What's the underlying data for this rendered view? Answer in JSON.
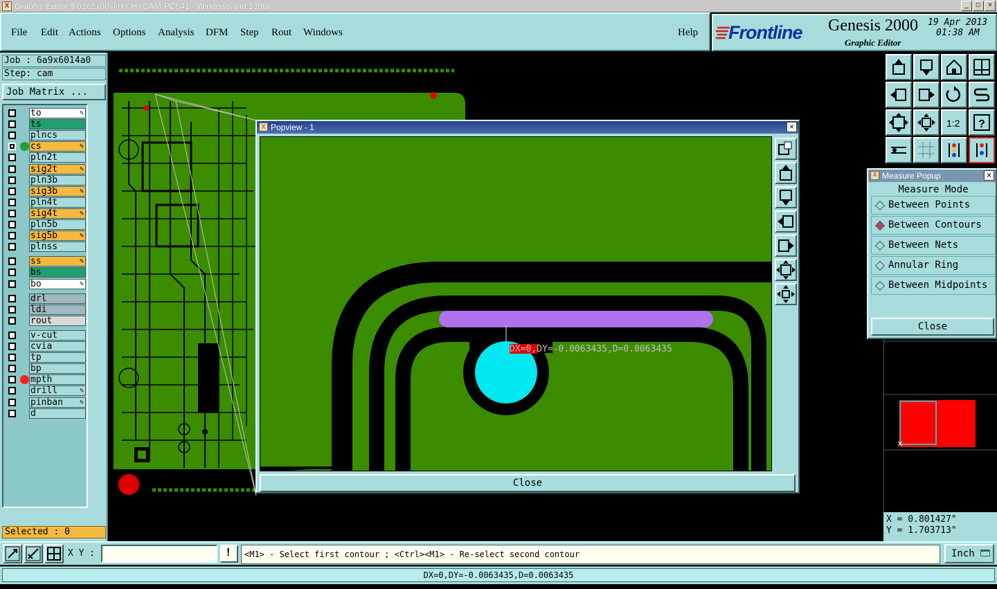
{
  "window": {
    "title": "Graphic Editor 9.02c2 (00@HY-HYCAM-PC041 - Windows, pid:1396)",
    "controls": [
      "_",
      "□",
      "×"
    ]
  },
  "menu": {
    "items": [
      "File",
      "Edit",
      "Actions",
      "Options",
      "Analysis",
      "DFM",
      "Step",
      "Rout",
      "Windows"
    ],
    "help": "Help"
  },
  "brand": {
    "logo": "Frontline",
    "product": "Genesis 2000",
    "subtitle": "Graphic Editor",
    "date": "19 Apr 2013",
    "time": "01:38 AM"
  },
  "job": {
    "job_label": "Job : 6a9x6014a0",
    "step_label": "Step: cam",
    "matrix_button": "Job Matrix ..."
  },
  "layers": [
    {
      "name": "to",
      "color": "#ffffff",
      "flag": "pencil"
    },
    {
      "name": "ts",
      "color": "#20a070",
      "flag": ""
    },
    {
      "name": "plncs",
      "color": "#a8dcdc",
      "flag": ""
    },
    {
      "name": "cs",
      "color": "#f5b840",
      "flag": "pencil",
      "active": true,
      "dot": "#20a040"
    },
    {
      "name": "pln2t",
      "color": "#a8dcdc",
      "flag": ""
    },
    {
      "name": "sig2t",
      "color": "#f5b840",
      "flag": "pencil"
    },
    {
      "name": "pln3b",
      "color": "#a8dcdc",
      "flag": ""
    },
    {
      "name": "sig3b",
      "color": "#f5b840",
      "flag": "pencil"
    },
    {
      "name": "pln4t",
      "color": "#a8dcdc",
      "flag": ""
    },
    {
      "name": "sig4t",
      "color": "#f5b840",
      "flag": "pencil"
    },
    {
      "name": "pln5b",
      "color": "#a8dcdc",
      "flag": ""
    },
    {
      "name": "sig5b",
      "color": "#f5b840",
      "flag": "pencil"
    },
    {
      "name": "plnss",
      "color": "#a8dcdc",
      "flag": ""
    },
    {
      "name": "ss",
      "color": "#f5b840",
      "flag": "pencil"
    },
    {
      "name": "bs",
      "color": "#20a070",
      "flag": ""
    },
    {
      "name": "bo",
      "color": "#ffffff",
      "flag": "pencil"
    },
    {
      "name": "drl",
      "color": "#a0b8c0",
      "flag": ""
    },
    {
      "name": "ldi",
      "color": "#a0b8c0",
      "flag": ""
    },
    {
      "name": "rout",
      "color": "#d8d8d8",
      "flag": ""
    },
    {
      "name": "v-cut",
      "color": "#a8dcdc",
      "flag": ""
    },
    {
      "name": "cvia",
      "color": "#a8dcdc",
      "flag": ""
    },
    {
      "name": "tp",
      "color": "#a8dcdc",
      "flag": ""
    },
    {
      "name": "bp",
      "color": "#a8dcdc",
      "flag": ""
    },
    {
      "name": "mpth",
      "color": "#a8dcdc",
      "flag": "",
      "dot": "#ff2020"
    },
    {
      "name": "drill",
      "color": "#a8dcdc",
      "flag": "pencil"
    },
    {
      "name": "pinban",
      "color": "#a8dcdc",
      "flag": "pencil"
    },
    {
      "name": "d",
      "color": "#a8dcdc",
      "flag": ""
    }
  ],
  "selected": "Selected : 0",
  "popview": {
    "title": "Popview - 1",
    "measure_text": "DX=0,DY=-0.0063435,D=0.0063435",
    "close": "Close"
  },
  "measure_popup": {
    "title": "Measure Popup",
    "heading": "Measure Mode",
    "options": [
      "Between Points",
      "Between Contours",
      "Between Nets",
      "Annular Ring",
      "Between Midpoints"
    ],
    "selected_option": "Between Contours",
    "close": "Close"
  },
  "coords": {
    "x": "X = 0.801427\"",
    "y": "Y = 1.703713\""
  },
  "command": {
    "xy_label": "X Y :",
    "xy_value": "",
    "prompt": "<M1> - Select first contour ; <Ctrl><M1> - Re-select second contour",
    "units": "Inch"
  },
  "status": "DX=0,DY=-0.0063435,D=0.0063435",
  "colors": {
    "panel": "#a8dcdc",
    "board": "#3c8c00",
    "trace_highlight": "#b070f0",
    "pad_highlight": "#00e8f0",
    "accent_orange": "#f5b840"
  }
}
